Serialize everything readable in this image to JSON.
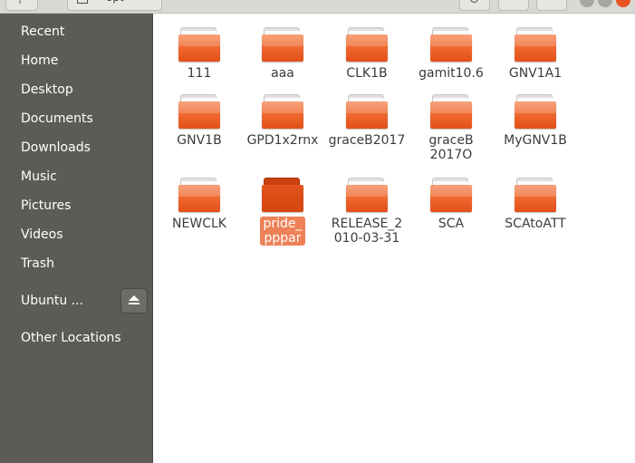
{
  "header": {
    "path_segment": "opt"
  },
  "sidebar": {
    "items": [
      {
        "label": "Recent"
      },
      {
        "label": "Home"
      },
      {
        "label": "Desktop"
      },
      {
        "label": "Documents"
      },
      {
        "label": "Downloads"
      },
      {
        "label": "Music"
      },
      {
        "label": "Pictures"
      },
      {
        "label": "Videos"
      },
      {
        "label": "Trash"
      },
      {
        "label": "Ubuntu ..."
      },
      {
        "label": "Other Locations"
      }
    ]
  },
  "files": [
    {
      "name": "111"
    },
    {
      "name": "aaa"
    },
    {
      "name": "CLK1B"
    },
    {
      "name": "gamit10.6"
    },
    {
      "name": "GNV1A1"
    },
    {
      "name": "GNV1B"
    },
    {
      "name": "GPD1x2rnx"
    },
    {
      "name": "graceB2017"
    },
    {
      "name": "graceB2017O"
    },
    {
      "name": "MyGNV1B"
    },
    {
      "name": "NEWCLK"
    },
    {
      "name": "pride_pppar",
      "selected": true
    },
    {
      "name": "RELEASE_2010-03-31"
    },
    {
      "name": "SCA"
    },
    {
      "name": "SCAtoATT"
    }
  ],
  "icons": {
    "folder": "folder-icon",
    "eject": "eject-icon",
    "home": "home-icon",
    "search": "search-icon"
  },
  "colors": {
    "accent": "#e95420",
    "sidebar_bg": "#5d5b55",
    "selection": "#ee8157"
  }
}
